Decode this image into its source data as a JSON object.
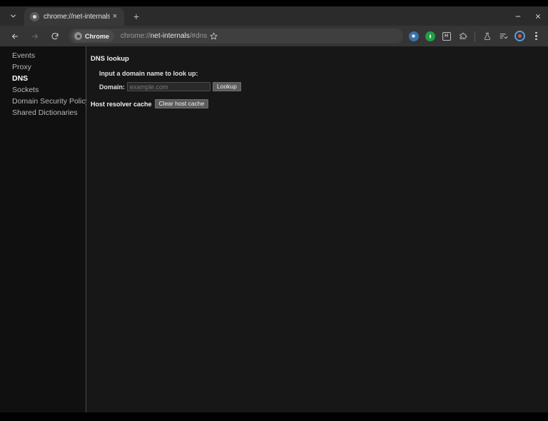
{
  "window": {
    "controls": {
      "minimize_label": "Minimize",
      "close_label": "Close"
    }
  },
  "tabstrip": {
    "tab_search_icon": "chevron-down-icon",
    "new_tab_label": "+",
    "tabs": [
      {
        "title": "chrome://net-internals/#dn",
        "favicon": "chrome-globe-icon",
        "close_label": "×",
        "active": true
      }
    ]
  },
  "toolbar": {
    "back_label": "←",
    "forward_label": "→",
    "reload_label": "↻",
    "chrome_chip_label": "Chrome",
    "url_scheme": "chrome://",
    "url_host": "net-internals",
    "url_path": "/#dns",
    "url_full": "chrome://net-internals/#dns",
    "bookmark_icon": "star-icon",
    "icons": [
      {
        "name": "extension-icon-1",
        "glyph": ""
      },
      {
        "name": "extension-icon-2",
        "glyph": ""
      },
      {
        "name": "save-page-icon",
        "glyph": "H"
      },
      {
        "name": "extensions-puzzle-icon",
        "glyph": ""
      },
      {
        "name": "experiments-flask-icon",
        "glyph": ""
      },
      {
        "name": "reading-list-icon",
        "glyph": ""
      }
    ],
    "profile_icon": "profile-avatar-icon",
    "menu_icon": "three-dot-menu-icon"
  },
  "sidebar": {
    "items": [
      {
        "label": "Events",
        "selected": false
      },
      {
        "label": "Proxy",
        "selected": false
      },
      {
        "label": "DNS",
        "selected": true
      },
      {
        "label": "Sockets",
        "selected": false
      },
      {
        "label": "Domain Security Policy",
        "selected": false
      },
      {
        "label": "Shared Dictionaries",
        "selected": false
      }
    ]
  },
  "main": {
    "heading": "DNS lookup",
    "prompt": "Input a domain name to look up:",
    "domain_label": "Domain:",
    "domain_value": "",
    "domain_placeholder": "example.com",
    "lookup_button": "Lookup",
    "cache_label": "Host resolver cache",
    "clear_cache_button": "Clear host cache"
  },
  "colors": {
    "window_chrome": "#2b2b2b",
    "toolbar": "#353535",
    "page_background": "#171717",
    "sidebar_background": "#101010",
    "accent_blue": "#5b9ad6",
    "accent_green": "#1f9e47",
    "notification_red": "#d9534f"
  }
}
